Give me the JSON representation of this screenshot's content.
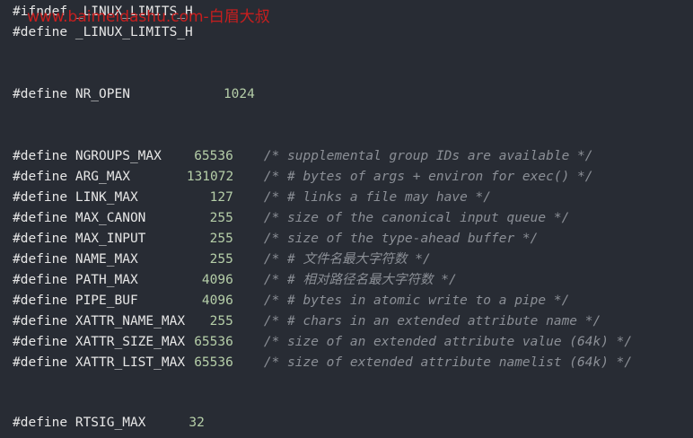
{
  "code": {
    "header_lines": [
      {
        "directive": "#ifndef",
        "name": "_LINUX_LIMITS_H"
      },
      {
        "directive": "#define",
        "name": "_LINUX_LIMITS_H"
      }
    ],
    "nr_open": {
      "directive": "#define",
      "name": "NR_OPEN",
      "value": "1024"
    },
    "defines": [
      {
        "directive": "#define",
        "name": "NGROUPS_MAX",
        "value": "65536",
        "comment": "/* supplemental group IDs are available */"
      },
      {
        "directive": "#define",
        "name": "ARG_MAX",
        "value": "131072",
        "comment": "/* # bytes of args + environ for exec() */"
      },
      {
        "directive": "#define",
        "name": "LINK_MAX",
        "value": "127",
        "comment": "/* # links a file may have */"
      },
      {
        "directive": "#define",
        "name": "MAX_CANON",
        "value": "255",
        "comment": "/* size of the canonical input queue */"
      },
      {
        "directive": "#define",
        "name": "MAX_INPUT",
        "value": "255",
        "comment": "/* size of the type-ahead buffer */"
      },
      {
        "directive": "#define",
        "name": "NAME_MAX",
        "value": "255",
        "comment": "/* # 文件名最大字符数 */"
      },
      {
        "directive": "#define",
        "name": "PATH_MAX",
        "value": "4096",
        "comment": "/* # 相对路径名最大字符数 */"
      },
      {
        "directive": "#define",
        "name": "PIPE_BUF",
        "value": "4096",
        "comment": "/* # bytes in atomic write to a pipe */"
      },
      {
        "directive": "#define",
        "name": "XATTR_NAME_MAX",
        "value": "255",
        "comment": "/* # chars in an extended attribute name */"
      },
      {
        "directive": "#define",
        "name": "XATTR_SIZE_MAX",
        "value": "65536",
        "comment": "/* size of an extended attribute value (64k) */"
      },
      {
        "directive": "#define",
        "name": "XATTR_LIST_MAX",
        "value": "65536",
        "comment": "/* size of extended attribute namelist (64k) */"
      }
    ],
    "rtsig": {
      "directive": "#define",
      "name": "RTSIG_MAX",
      "value": "32"
    }
  },
  "watermark": {
    "text": "www.baimeidashu.com-白眉大叔"
  },
  "colors": {
    "background": "#282c34",
    "text": "#e6e6e6",
    "number": "#b5cea8",
    "comment": "#8b8f96",
    "watermark": "#c81e1e"
  }
}
